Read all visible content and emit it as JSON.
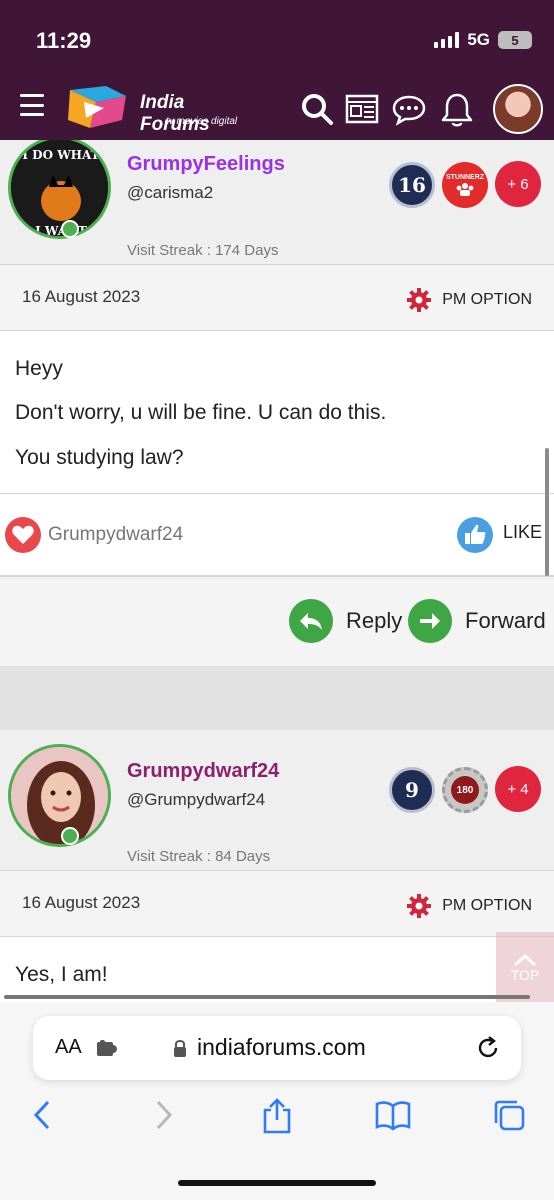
{
  "status": {
    "time": "11:29",
    "network": "5G",
    "battery": "5"
  },
  "header": {
    "logo_title": "India Forums",
    "logo_sub": "tv  movies  digital",
    "icons": [
      "menu-icon",
      "search-icon",
      "news-icon",
      "chat-icon",
      "bell-icon",
      "avatar"
    ]
  },
  "posts": [
    {
      "username": "GrumpyFeelings",
      "handle": "@carisma2",
      "streak": "Visit Streak : 174 Days",
      "badge_number": "16",
      "badge_text": "STUNNERZ",
      "more_badges": "+ 6",
      "date": "16 August 2023",
      "pm_option": "PM OPTION",
      "lines": [
        "Heyy",
        "Don't worry, u will be fine. U can do this.",
        "You studying law?"
      ],
      "liker": "Grumpydwarf24",
      "like_label": "LIKE",
      "reply_label": "Reply",
      "forward_label": "Forward"
    },
    {
      "username": "Grumpydwarf24",
      "handle": "@Grumpydwarf24",
      "streak": "Visit Streak : 84 Days",
      "badge_number": "9",
      "badge_text": "180",
      "more_badges": "+ 4",
      "date": "16 August 2023",
      "pm_option": "PM OPTION",
      "lines": [
        "Yes, I am!"
      ]
    }
  ],
  "avatar_text": {
    "top": "I DO WHAT",
    "bottom": "I WANT"
  },
  "top_button": "TOP",
  "browser": {
    "aa": "AA",
    "url": "indiaforums.com"
  },
  "colors": {
    "header": "#3f1538",
    "username1": "#9b30e8",
    "username2": "#8e1f6e",
    "accent_green": "#3ea645",
    "badge_red": "#e0253f",
    "ios_blue": "#2f7cf6"
  }
}
